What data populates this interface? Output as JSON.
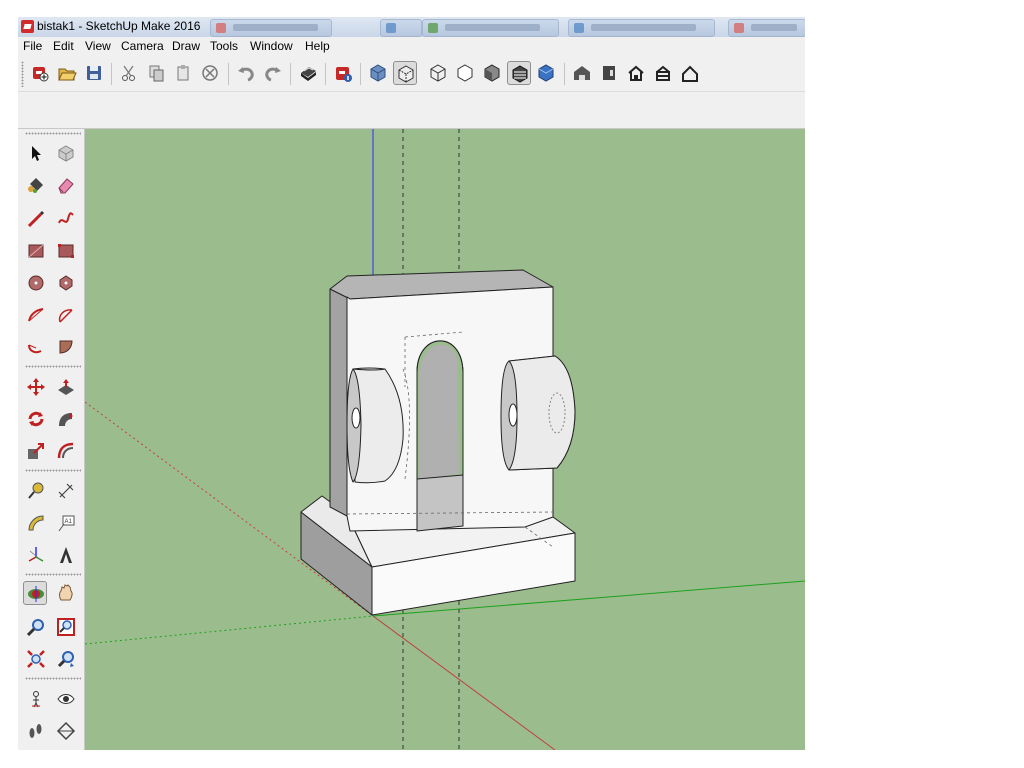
{
  "window": {
    "title": "bistak1 - SketchUp Make 2016"
  },
  "menu": [
    "File",
    "Edit",
    "View",
    "Camera",
    "Draw",
    "Tools",
    "Window",
    "Help"
  ],
  "toolbar_icons": [
    "new-file-icon",
    "open-folder-icon",
    "save-icon",
    "cut-icon",
    "copy-icon",
    "paste-icon",
    "erase-icon",
    "undo-icon",
    "redo-icon",
    "print-icon",
    "model-info-icon",
    "xray-icon",
    "back-edges-icon",
    "wireframe-icon",
    "hidden-line-icon",
    "shaded-icon",
    "shaded-textures-icon",
    "monochrome-icon",
    "iso-view-icon",
    "top-view-icon",
    "front-view-icon",
    "right-view-icon",
    "back-view-icon"
  ],
  "left_tools": [
    "select-tool-icon",
    "make-component-icon",
    "paint-bucket-icon",
    "eraser-icon",
    "line-tool-icon",
    "freehand-tool-icon",
    "rectangle-tool-icon",
    "rotated-rectangle-icon",
    "circle-tool-icon",
    "polygon-tool-icon",
    "arc-tool-icon",
    "two-point-arc-icon",
    "three-point-arc-icon",
    "pie-tool-icon",
    "move-tool-icon",
    "push-pull-icon",
    "rotate-tool-icon",
    "follow-me-icon",
    "scale-tool-icon",
    "offset-tool-icon",
    "tape-measure-icon",
    "dimension-tool-icon",
    "protractor-icon",
    "text-tool-icon",
    "axes-tool-icon",
    "3d-text-icon",
    "orbit-tool-icon",
    "pan-tool-icon",
    "zoom-tool-icon",
    "zoom-window-icon",
    "zoom-extents-icon",
    "previous-view-icon",
    "position-camera-icon",
    "look-around-icon",
    "walk-tool-icon",
    "section-plane-icon"
  ],
  "viewport": {
    "background": "#9bbd8d",
    "model": "bracket"
  },
  "colors": {
    "axis_blue": "#2d2dff",
    "axis_red": "#c04040",
    "axis_green": "#1ea01e",
    "face_light": "#f5f5f5",
    "face_gray": "#a8a8a8"
  }
}
